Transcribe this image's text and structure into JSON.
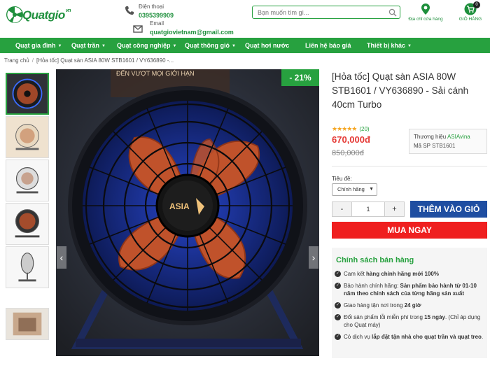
{
  "header": {
    "logo_text": "Quatgio",
    "logo_suffix": "vn",
    "phone_label": "Điện thoại",
    "phone_value": "0395399909",
    "email_label": "Email",
    "email_value": "quatgiovietnam@gmail.com",
    "search_placeholder": "Bạn muốn tìm gì...",
    "store_label": "Địa chỉ cửa hàng",
    "cart_label": "GIỎ HÀNG",
    "cart_count": "0"
  },
  "nav": {
    "items": [
      {
        "label": "Quạt gia đình",
        "has_dropdown": true
      },
      {
        "label": "Quạt trần",
        "has_dropdown": true
      },
      {
        "label": "Quạt công nghiệp",
        "has_dropdown": true
      },
      {
        "label": "Quạt thông gió",
        "has_dropdown": true
      },
      {
        "label": "Quạt hơi nước",
        "has_dropdown": false
      },
      {
        "label": "Liên hệ báo giá",
        "has_dropdown": false
      },
      {
        "label": "Thiết bị khác",
        "has_dropdown": true
      }
    ]
  },
  "breadcrumb": {
    "home": "Trang chủ",
    "current": "[Hỏa tốc] Quạt sàn ASIA 80W STB1601 / VY636890 -..."
  },
  "gallery": {
    "discount_badge": "- 21%",
    "prev_arrow": "‹",
    "next_arrow": "›",
    "image_brand_text": "ASIA",
    "image_banner_text": "ĐẾN VƯỢT MỌI GIỚI HẠN",
    "thumbnail_count": 6
  },
  "product": {
    "title": "[Hỏa tốc] Quạt sàn ASIA 80W STB1601 / VY636890 - Sải cánh 40cm Turbo",
    "stars": "★★★★★",
    "rating_count": "(20)",
    "price": "670,000đ",
    "old_price": "850,000đ",
    "brand_label": "Thương hiệu",
    "brand_value": "ASIAvina",
    "sku_label": "Mã SP",
    "sku_value": "STB1601",
    "option_label": "Tiêu đề:",
    "option_value": "Chính hãng",
    "quantity": "1",
    "minus": "-",
    "plus": "+",
    "add_to_cart": "THÊM VÀO GIỎ",
    "buy_now": "MUA NGAY"
  },
  "policy": {
    "title": "Chính sách bán hàng",
    "items": [
      {
        "pre": "Cam kết ",
        "bold": "hàng chính hãng mới 100%",
        "post": ""
      },
      {
        "pre": "Bảo hành chính hãng: ",
        "bold": "Sản phẩm bảo hành từ 01-10 năm theo chính sách của từng hãng sản xuất",
        "post": ""
      },
      {
        "pre": "Giao hàng tận nơi trong ",
        "bold": "24 giờ",
        "post": ""
      },
      {
        "pre": "Đổi sản phẩm lỗi miễn phí trong ",
        "bold": "15 ngày",
        "post": ". (Chỉ áp dụng cho Quạt máy)"
      },
      {
        "pre": "Có dịch vụ ",
        "bold": "lắp đặt tận nhà cho quạt trần và quạt treo",
        "post": "."
      }
    ]
  },
  "colors": {
    "brand_green": "#27a13f",
    "price_red": "#e53935",
    "add_cart_blue": "#1f4ea1",
    "buy_now_red": "#ef1f1f",
    "fan_blade": "#c0522b"
  }
}
